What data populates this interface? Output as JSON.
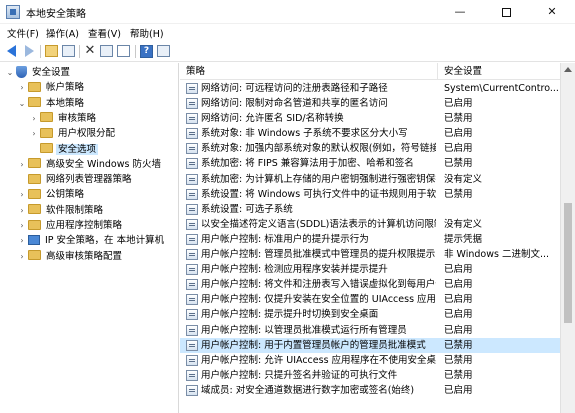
{
  "window": {
    "title": "本地安全策略",
    "minimize": "—",
    "close": "✕"
  },
  "menu": [
    "文件(F)",
    "操作(A)",
    "查看(V)",
    "帮助(H)"
  ],
  "toolbar_icons": [
    "back-arrow-icon",
    "forward-arrow-icon",
    "folder-up-icon",
    "show-tree-icon",
    "delete-icon",
    "properties-icon",
    "export-icon",
    "help-icon",
    "view-icon"
  ],
  "tree": [
    {
      "label": "安全设置",
      "level": 0,
      "expanded": true,
      "icon": "shield-icon"
    },
    {
      "label": "帐户策略",
      "level": 1,
      "expanded": false,
      "icon": "folder-icon"
    },
    {
      "label": "本地策略",
      "level": 1,
      "expanded": true,
      "icon": "folder-icon"
    },
    {
      "label": "审核策略",
      "level": 2,
      "expanded": false,
      "icon": "folder-icon"
    },
    {
      "label": "用户权限分配",
      "level": 2,
      "expanded": false,
      "icon": "folder-icon"
    },
    {
      "label": "安全选项",
      "level": 2,
      "expanded": null,
      "icon": "folder-icon",
      "selected": true
    },
    {
      "label": "高级安全 Windows 防火墙",
      "level": 1,
      "expanded": false,
      "icon": "folder-icon"
    },
    {
      "label": "网络列表管理器策略",
      "level": 1,
      "expanded": null,
      "icon": "folder-icon"
    },
    {
      "label": "公钥策略",
      "level": 1,
      "expanded": false,
      "icon": "folder-icon"
    },
    {
      "label": "软件限制策略",
      "level": 1,
      "expanded": false,
      "icon": "folder-icon"
    },
    {
      "label": "应用程序控制策略",
      "level": 1,
      "expanded": false,
      "icon": "folder-icon"
    },
    {
      "label": "IP 安全策略，在 本地计算机",
      "level": 1,
      "expanded": false,
      "icon": "computer-icon"
    },
    {
      "label": "高级审核策略配置",
      "level": 1,
      "expanded": false,
      "icon": "folder-icon"
    }
  ],
  "columns": {
    "policy": "策略",
    "setting": "安全设置"
  },
  "rows": [
    {
      "policy": "网络访问: 可远程访问的注册表路径和子路径",
      "setting": "System\\CurrentContro..."
    },
    {
      "policy": "网络访问: 限制对命名管道和共享的匿名访问",
      "setting": "已启用"
    },
    {
      "policy": "网络访问: 允许匿名 SID/名称转换",
      "setting": "已禁用"
    },
    {
      "policy": "系统对象: 非 Windows 子系统不要求区分大小写",
      "setting": "已启用"
    },
    {
      "policy": "系统对象: 加强内部系统对象的默认权限(例如，符号链接)",
      "setting": "已启用"
    },
    {
      "policy": "系统加密: 将 FIPS 兼容算法用于加密、哈希和签名",
      "setting": "已禁用"
    },
    {
      "policy": "系统加密: 为计算机上存储的用户密钥强制进行强密钥保护",
      "setting": "没有定义"
    },
    {
      "policy": "系统设置: 将 Windows 可执行文件中的证书规则用于软件限制...",
      "setting": "已禁用"
    },
    {
      "policy": "系统设置: 可选子系统",
      "setting": ""
    },
    {
      "policy": "以安全描述符定义语言(SDDL)语法表示的计算机访问限制",
      "setting": "没有定义"
    },
    {
      "policy": "用户帐户控制: 标准用户的提升提示行为",
      "setting": "提示凭据"
    },
    {
      "policy": "用户帐户控制: 管理员批准模式中管理员的提升权限提示的...",
      "setting": "非 Windows 二进制文..."
    },
    {
      "policy": "用户帐户控制: 检测应用程序安装并提示提升",
      "setting": "已启用"
    },
    {
      "policy": "用户帐户控制: 将文件和注册表写入错误虚拟化到每用户位置",
      "setting": "已启用"
    },
    {
      "policy": "用户帐户控制: 仅提升安装在安全位置的 UIAccess 应用程序",
      "setting": "已启用"
    },
    {
      "policy": "用户帐户控制: 提示提升时切换到安全桌面",
      "setting": "已启用"
    },
    {
      "policy": "用户帐户控制: 以管理员批准模式运行所有管理员",
      "setting": "已启用"
    },
    {
      "policy": "用户帐户控制: 用于内置管理员帐户的管理员批准模式",
      "setting": "已禁用",
      "selected": true
    },
    {
      "policy": "用户帐户控制: 允许 UIAccess 应用程序在不使用安全桌面...",
      "setting": "已禁用"
    },
    {
      "policy": "用户帐户控制: 只提升签名并验证的可执行文件",
      "setting": "已禁用"
    },
    {
      "policy": "域成员: 对安全通道数据进行数字加密或签名(始终)",
      "setting": "已启用"
    }
  ],
  "colors": {
    "selection": "#cce8ff",
    "accent": "#2a73d9",
    "folder": "#e8c15a"
  }
}
